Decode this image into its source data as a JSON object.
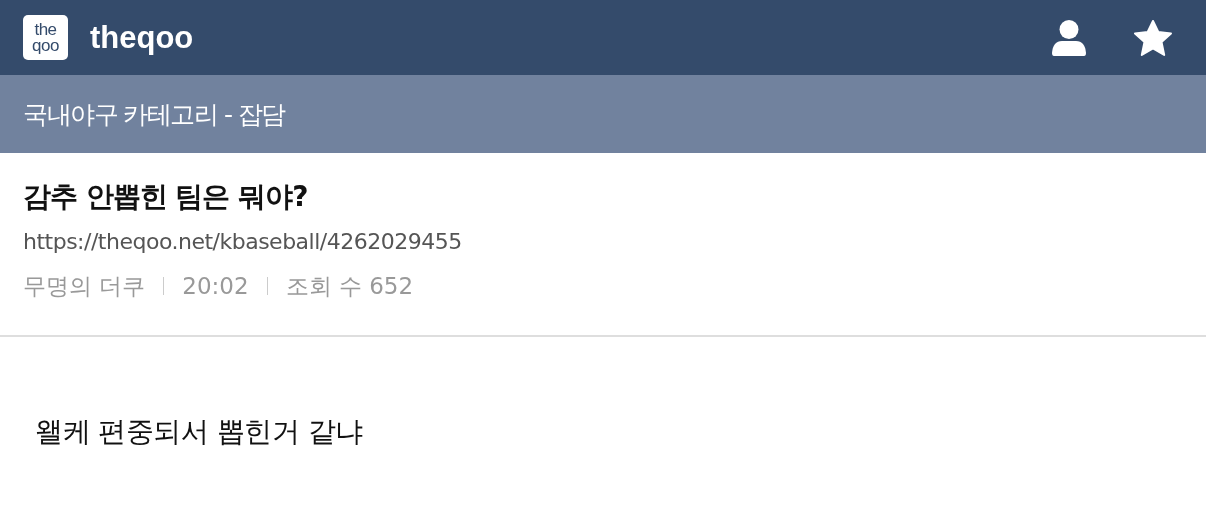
{
  "header": {
    "logo_lines": [
      "the",
      "qoo"
    ],
    "site_name": "theqoo"
  },
  "category_bar": {
    "text": "국내야구 카테고리 - 잡담"
  },
  "post": {
    "title": "감추 안뽑힌 팀은 뭐야?",
    "url": "https://theqoo.net/kbaseball/4262029455",
    "meta": [
      "무명의 더쿠",
      "20:02",
      "조회 수 652"
    ],
    "body": "왤케 편중되서 뽑힌거 같냐"
  }
}
